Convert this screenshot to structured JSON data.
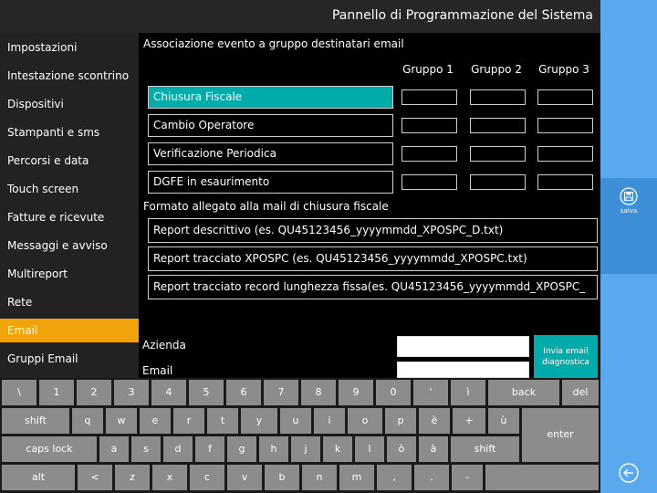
{
  "header": {
    "title": "Pannello di Programmazione del Sistema"
  },
  "sidebar": {
    "items": [
      {
        "label": "Impostazioni",
        "active": false
      },
      {
        "label": "Intestazione scontrino",
        "active": false
      },
      {
        "label": "Dispositivi",
        "active": false
      },
      {
        "label": "Stampanti e sms",
        "active": false
      },
      {
        "label": "Percorsi e data",
        "active": false
      },
      {
        "label": "Touch screen",
        "active": false
      },
      {
        "label": "Fatture e ricevute",
        "active": false
      },
      {
        "label": "Messaggi e avviso",
        "active": false
      },
      {
        "label": "Multireport",
        "active": false
      },
      {
        "label": "Rete",
        "active": false
      },
      {
        "label": "Email",
        "active": true
      },
      {
        "label": "Gruppi Email",
        "active": false
      }
    ]
  },
  "association": {
    "title": "Associazione evento a gruppo destinatari email",
    "groups": [
      "Gruppo 1",
      "Gruppo 2",
      "Gruppo 3"
    ],
    "events": [
      {
        "label": "Chiusura Fiscale",
        "selected": true
      },
      {
        "label": "Cambio Operatore",
        "selected": false
      },
      {
        "label": "Verificazione Periodica",
        "selected": false
      },
      {
        "label": "DGFE in esaurimento",
        "selected": false
      }
    ]
  },
  "attachment_format": {
    "title": "Formato allegato alla mail di chiusura fiscale",
    "options": [
      "Report descrittivo (es. QU45123456_yyyymmdd_XPOSPC_D.txt)",
      "Report tracciato XPOSPC (es. QU45123456_yyyymmdd_XPOSPC.txt)",
      "Report tracciato record lunghezza fissa(es. QU45123456_yyyymmdd_XPOSPC_"
    ]
  },
  "fields": {
    "azienda_label": "Azienda",
    "azienda_value": "",
    "email_label": "Email",
    "email_value": "",
    "diag_button": "Invia email diagnostica"
  },
  "actions": {
    "save_label": "salva",
    "save_icon": "floppy-disk-icon",
    "back_icon": "back-arrow-icon"
  },
  "keyboard": {
    "rows": [
      [
        "\\",
        "1",
        "2",
        "3",
        "4",
        "5",
        "6",
        "7",
        "8",
        "9",
        "0",
        "'",
        "ì",
        "back",
        "del"
      ],
      [
        "shift",
        "q",
        "w",
        "e",
        "r",
        "t",
        "y",
        "u",
        "i",
        "o",
        "p",
        "è",
        "+",
        "ù",
        "enter"
      ],
      [
        "caps lock",
        "a",
        "s",
        "d",
        "f",
        "g",
        "h",
        "j",
        "k",
        "l",
        "ò",
        "à",
        "shift"
      ],
      [
        "alt",
        "<",
        "z",
        "x",
        "c",
        "v",
        "b",
        "n",
        "m",
        ",",
        ".",
        "-"
      ]
    ]
  },
  "colors": {
    "accent_teal": "#00aba9",
    "active_orange": "#f0a30a",
    "panel_blue": "#5aa9ee",
    "key_gray": "#8c8c8c"
  }
}
